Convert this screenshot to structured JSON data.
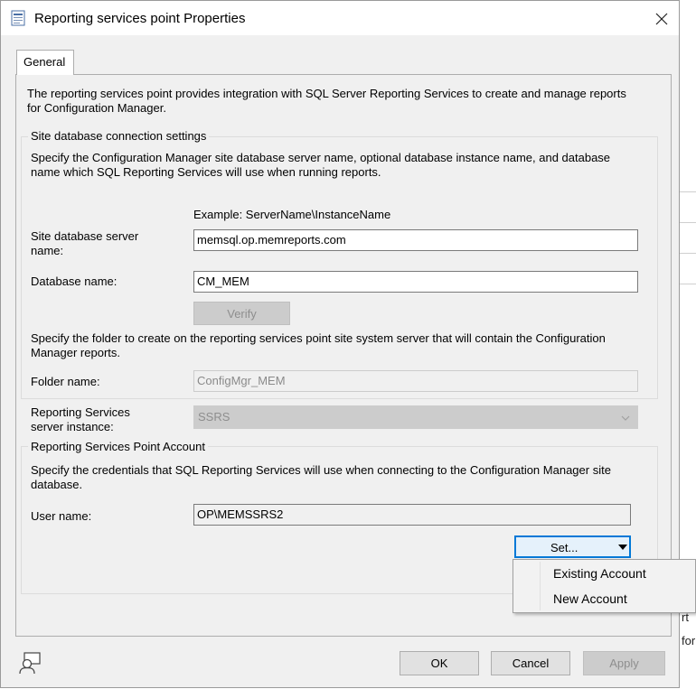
{
  "window": {
    "title": "Reporting services point Properties"
  },
  "tabs": [
    {
      "label": "General"
    }
  ],
  "intro": {
    "line1": "The reporting services point provides integration with SQL Server Reporting Services to create and manage reports",
    "line2": "for Configuration Manager."
  },
  "site_db": {
    "legend": "Site database connection settings",
    "desc_line1": "Specify the Configuration Manager site database server name, optional database instance name, and database",
    "desc_line2": "name which SQL Reporting Services will use when running reports.",
    "example": "Example: ServerName\\InstanceName",
    "server_label_line1": "Site database server",
    "server_label_line2": "name:",
    "server_value": "memsql.op.memreports.com",
    "dbname_label": "Database name:",
    "dbname_value": "CM_MEM",
    "verify_label": "Verify",
    "folder_desc_line1": "Specify the folder to create on the reporting services point site system server that will contain the Configuration",
    "folder_desc_line2": "Manager reports.",
    "folder_label": "Folder name:",
    "folder_value": "ConfigMgr_MEM"
  },
  "instance": {
    "label_line1": "Reporting Services",
    "label_line2": "server instance:",
    "value": "SSRS"
  },
  "account": {
    "legend": "Reporting Services Point Account",
    "desc_line1": "Specify the credentials that SQL Reporting Services will use when connecting to the Configuration Manager site",
    "desc_line2": "database.",
    "user_label": "User name:",
    "user_value": "OP\\MEMSSRS2",
    "set_label": "Set...",
    "menu": [
      {
        "label": "Existing Account"
      },
      {
        "label": "New Account"
      }
    ]
  },
  "footer": {
    "ok_label": "OK",
    "cancel_label": "Cancel",
    "apply_label": "Apply"
  },
  "background": {
    "frag1": "rt",
    "frag2": "for"
  }
}
